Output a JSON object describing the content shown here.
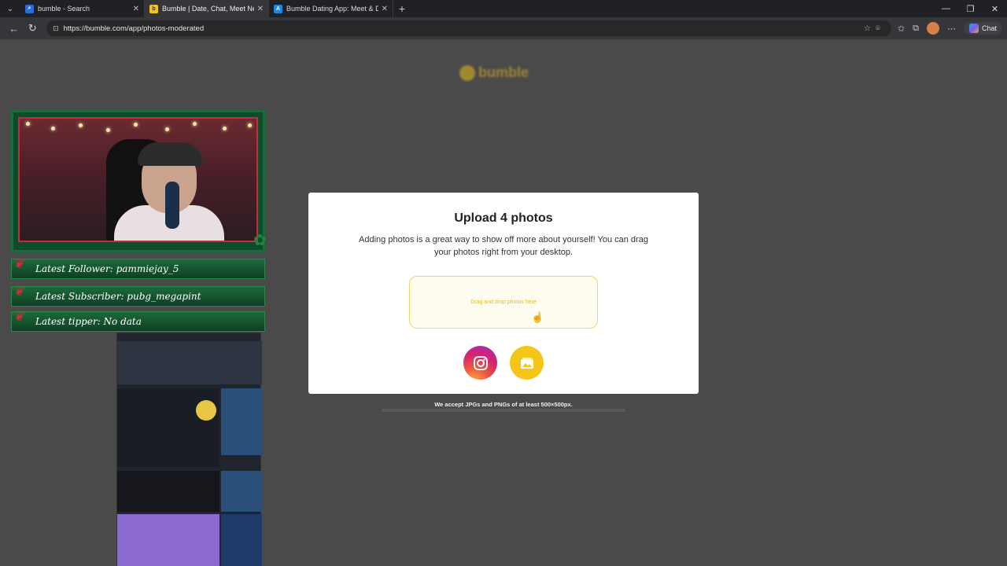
{
  "browser": {
    "tabs": [
      {
        "title": "bumble - Search",
        "icon": "search-icon",
        "active": false
      },
      {
        "title": "Bumble | Date, Chat, Meet New P",
        "icon": "bumble-favicon",
        "active": true
      },
      {
        "title": "Bumble Dating App: Meet & Date",
        "icon": "app-store-favicon",
        "active": false
      }
    ],
    "url": "https://bumble.com/app/photos-moderated",
    "chat_label": "Chat"
  },
  "page": {
    "logo_text": "bumble",
    "modal": {
      "title": "Upload 4 photos",
      "description": "Adding photos is a great way to show off more about yourself! You can drag your photos right from your desktop.",
      "dropzone_text": "Drag and drop photos here",
      "instagram_icon": "instagram-icon",
      "gallery_icon": "gallery-icon"
    },
    "accept_note": "We accept JPGs and PNGs of at least 500×500px."
  },
  "stream_overlay": {
    "latest_follower": "Latest Follower: pammiejay_5",
    "latest_subscriber": "Latest Subscriber: pubg_megapint",
    "latest_tipper": "Latest tipper: No data"
  },
  "colors": {
    "bumble_yellow": "#f5c518",
    "overlay_green": "#1c6a3c",
    "overlay_red": "#c92b3a"
  }
}
